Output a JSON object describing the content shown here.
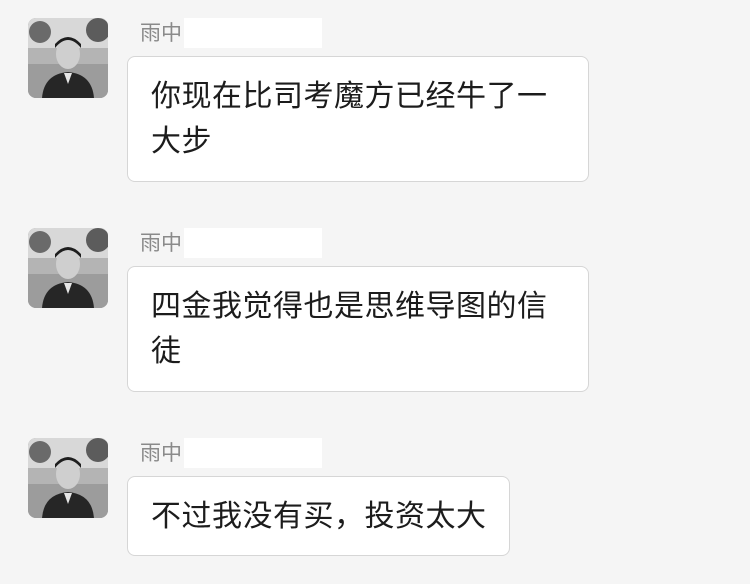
{
  "messages": [
    {
      "sender": "雨中",
      "text": "你现在比司考魔方已经牛了一大步"
    },
    {
      "sender": "雨中",
      "text": "四金我觉得也是思维导图的信徒"
    },
    {
      "sender": "雨中",
      "text": "不过我没有买，投资太大"
    }
  ]
}
